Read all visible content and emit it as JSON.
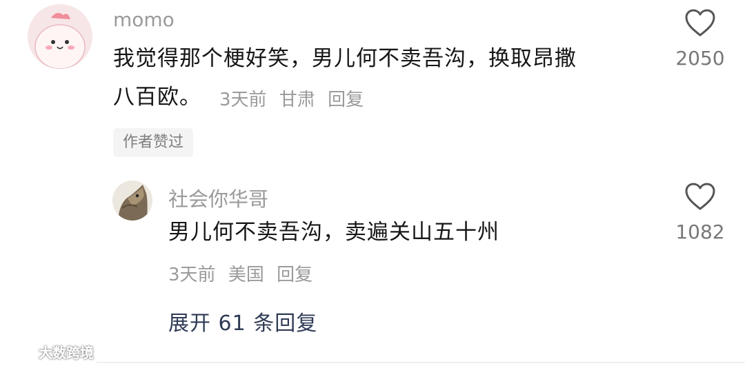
{
  "comments": [
    {
      "username": "momo",
      "avatar": "pink-mascot-avatar",
      "text_line1": "我觉得那个梗好笑，男儿何不卖吾沟，换取昂撒",
      "text_line2": "八百欧。",
      "time": "3天前",
      "location": "甘肃",
      "reply_label": "回复",
      "badge": "作者赞过",
      "likes": "2050",
      "like_icon": "heart-outline-icon"
    }
  ],
  "reply": {
    "username": "社会你华哥",
    "avatar": "cat-photo-avatar",
    "text": "男儿何不卖吾沟，卖遍关山五十州",
    "time": "3天前",
    "location": "美国",
    "reply_label": "回复",
    "likes": "1082",
    "like_icon": "heart-outline-icon"
  },
  "expand_replies": "展开 61 条回复",
  "watermark": "大数跨境",
  "colors": {
    "meta_gray": "#9a9a9a",
    "link_dark_blue": "#2e3a55"
  }
}
